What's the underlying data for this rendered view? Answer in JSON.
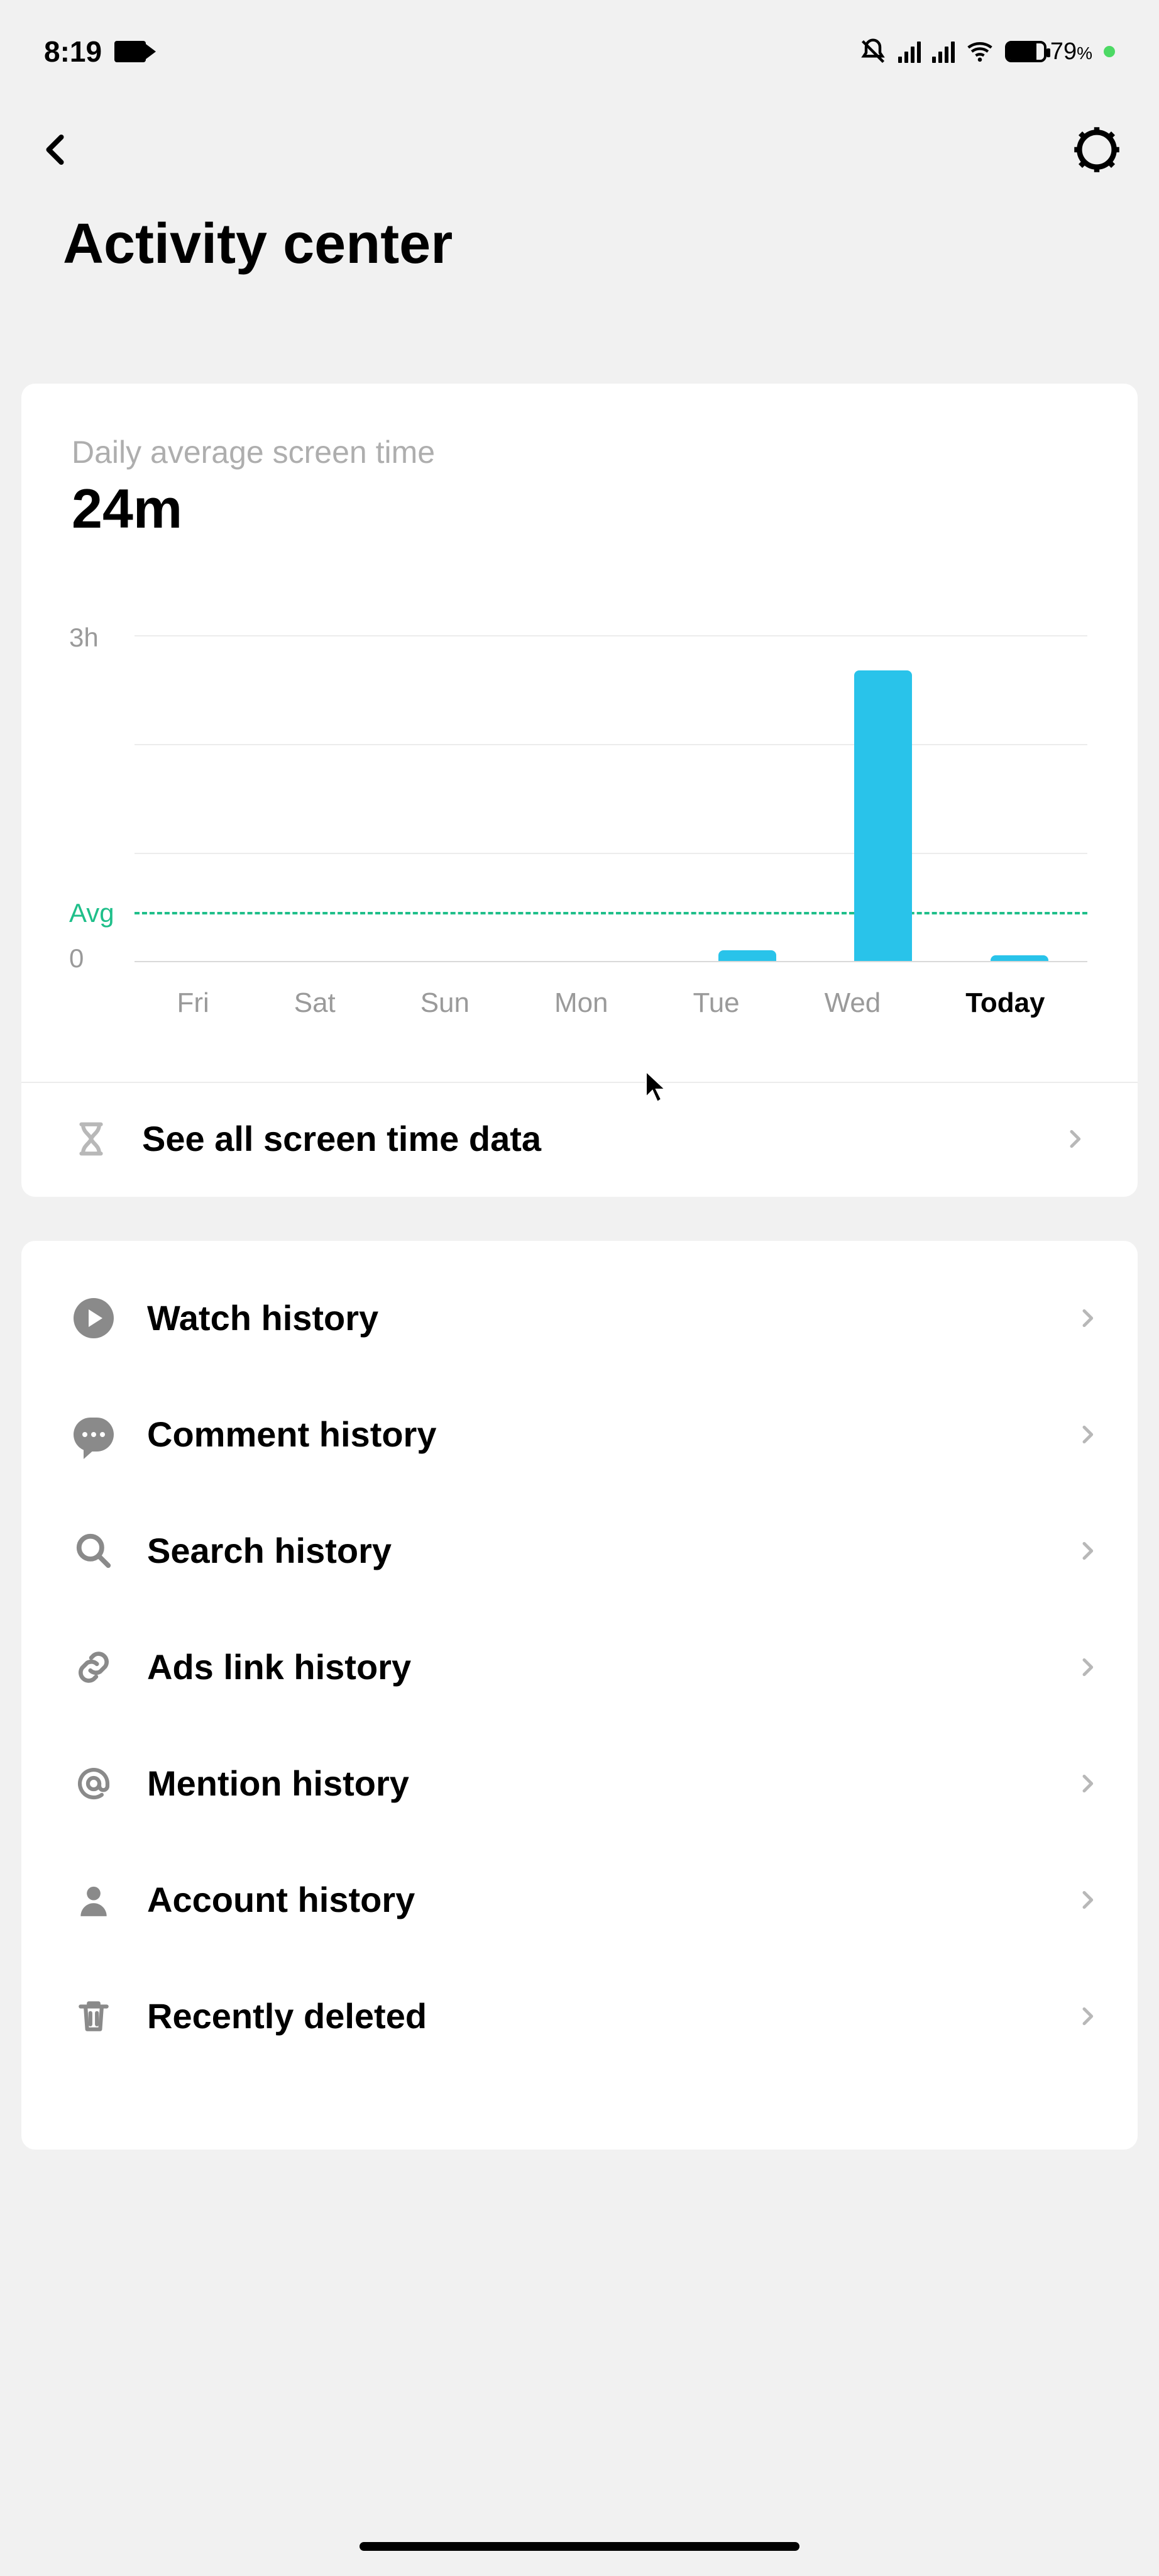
{
  "status": {
    "time": "8:19",
    "battery_pct": "79",
    "battery_pct_suffix": "%"
  },
  "header": {
    "title": "Activity center"
  },
  "screen_time": {
    "subtitle": "Daily average screen time",
    "value": "24m",
    "see_all": "See all screen time data"
  },
  "chart_data": {
    "type": "bar",
    "categories": [
      "Fri",
      "Sat",
      "Sun",
      "Mon",
      "Tue",
      "Wed",
      "Today"
    ],
    "values_minutes": [
      0,
      0,
      0,
      0,
      6,
      160,
      3
    ],
    "ylabel_top": "3h",
    "ylabel_bottom": "0",
    "avg_label": "Avg",
    "ylim_minutes": [
      0,
      180
    ]
  },
  "menu": [
    {
      "icon": "play",
      "label": "Watch history"
    },
    {
      "icon": "comment",
      "label": "Comment history"
    },
    {
      "icon": "search",
      "label": "Search history"
    },
    {
      "icon": "link",
      "label": "Ads link history"
    },
    {
      "icon": "at",
      "label": "Mention history"
    },
    {
      "icon": "account",
      "label": "Account history"
    },
    {
      "icon": "trash",
      "label": "Recently deleted"
    }
  ]
}
